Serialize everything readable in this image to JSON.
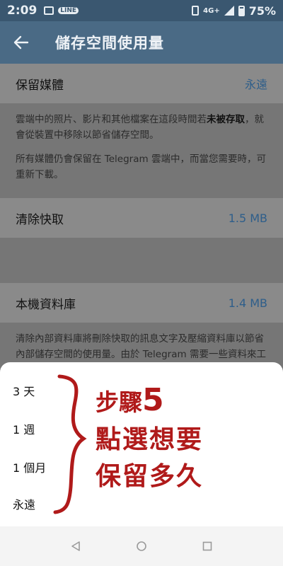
{
  "status_bar": {
    "time": "2:09",
    "line_badge": "LINE",
    "network": "4G+",
    "battery": "75%"
  },
  "toolbar": {
    "title": "儲存空間使用量"
  },
  "settings": {
    "keep_media": {
      "label": "保留媒體",
      "value": "永遠"
    },
    "keep_media_info_1a": "雲端中的照片、影片和其他檔案在這段時間若",
    "keep_media_info_1b": "未被存取",
    "keep_media_info_1c": "，就會從裝置中移除以節省儲存空間。",
    "keep_media_info_2": "所有媒體仍會保留在 Telegram 雲端中，而當您需要時，可重新下載。",
    "clear_cache": {
      "label": "清除快取",
      "value": "1.5 MB"
    },
    "local_db": {
      "label": "本機資料庫",
      "value": "1.4 MB"
    },
    "local_db_info": "清除內部資料庫將刪除快取的訊息文字及壓縮資料庫以節省內部儲存空間的使用量。由於 Telegram 需要一些資料來工作，資料庫的大小將不會完全歸"
  },
  "sheet": {
    "options": [
      "3 天",
      "1 週",
      "1 個月",
      "永遠"
    ]
  },
  "annotation": {
    "line1_text": "步驟",
    "line1_number": "5",
    "line2": "點選想要",
    "line3": "保留多久",
    "color": "#b01a1a"
  },
  "colors": {
    "toolbar": "#4a6a85",
    "status_bar": "#3a5770",
    "accent_value": "#2e5e8a"
  }
}
